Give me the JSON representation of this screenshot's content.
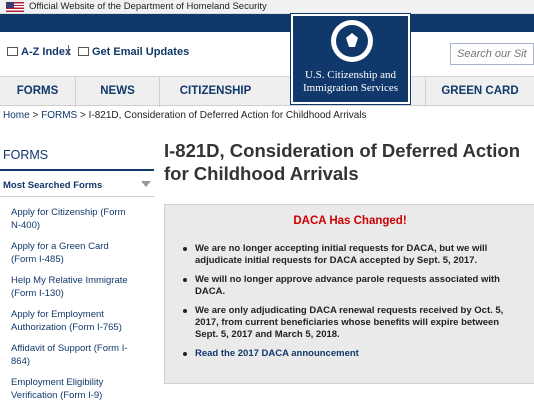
{
  "gov_banner": {
    "text": "Official Website of the Department of Homeland Security"
  },
  "utility": {
    "az_index": "A-Z Index",
    "separator": "|",
    "email_updates": "Get Email Updates",
    "search_placeholder": "Search our Site"
  },
  "logo": {
    "line1": "U.S. Citizenship and",
    "line2": "Immigration Services"
  },
  "nav": {
    "forms": "FORMS",
    "news": "NEWS",
    "citizenship": "CITIZENSHIP",
    "green_card": "GREEN CARD"
  },
  "breadcrumb": {
    "home": "Home",
    "forms": "FORMS",
    "current": "I-821D, Consideration of Deferred Action for Childhood Arrivals"
  },
  "sidebar": {
    "title": "FORMS",
    "subtitle": "Most Searched Forms",
    "items": [
      "Apply for Citizenship (Form N-400)",
      "Apply for a Green Card (Form I-485)",
      "Help My Relative Immigrate (Form I-130)",
      "Apply for Employment Authorization (Form I-765)",
      "Affidavit of Support (Form I-864)",
      "Employment Eligibility Verification (Form I-9)"
    ]
  },
  "page_title": "I-821D, Consideration of Deferred Action for Childhood Arrivals",
  "alert": {
    "title": "DACA Has Changed!",
    "bullets": [
      "We are no longer accepting initial requests for DACA, but we will adjudicate initial requests for DACA accepted by Sept. 5, 2017.",
      "We will no longer approve advance parole requests associated with DACA.",
      "We are only adjudicating DACA renewal requests received by Oct. 5, 2017, from current beneficiaries whose benefits will expire between Sept. 5, 2017 and March 5, 2018."
    ],
    "link": "Read the 2017 DACA announcement"
  },
  "colors": {
    "brand_navy": "#11386b",
    "alert_red": "#cc0000",
    "alert_bg": "#eaeaea"
  }
}
